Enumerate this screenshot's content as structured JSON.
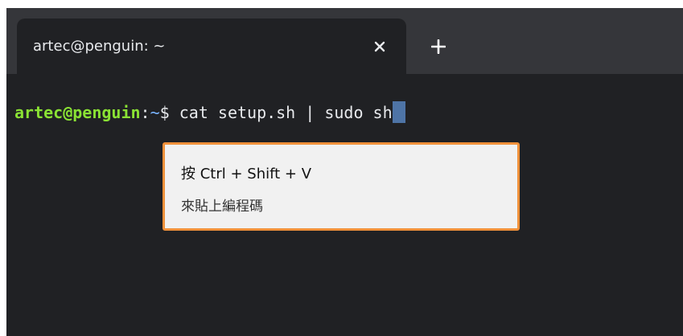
{
  "tab": {
    "title": "artec@penguin: ~",
    "close_icon": "close-icon",
    "new_tab_icon": "plus-icon"
  },
  "terminal": {
    "user_host": "artec@penguin",
    "colon": ":",
    "path": "~",
    "prompt_symbol": "$ ",
    "command": "cat setup.sh | sudo sh"
  },
  "tooltip": {
    "line1": "按 Ctrl + Shift + V",
    "line2": "來貼上編程碼"
  },
  "colors": {
    "tabbar_bg": "#35363a",
    "terminal_bg": "#202124",
    "prompt_user": "#8ae234",
    "prompt_path": "#7ab4ff",
    "cursor": "#4e74a6",
    "tooltip_border": "#f0913a",
    "tooltip_bg": "#f1f1f1"
  }
}
